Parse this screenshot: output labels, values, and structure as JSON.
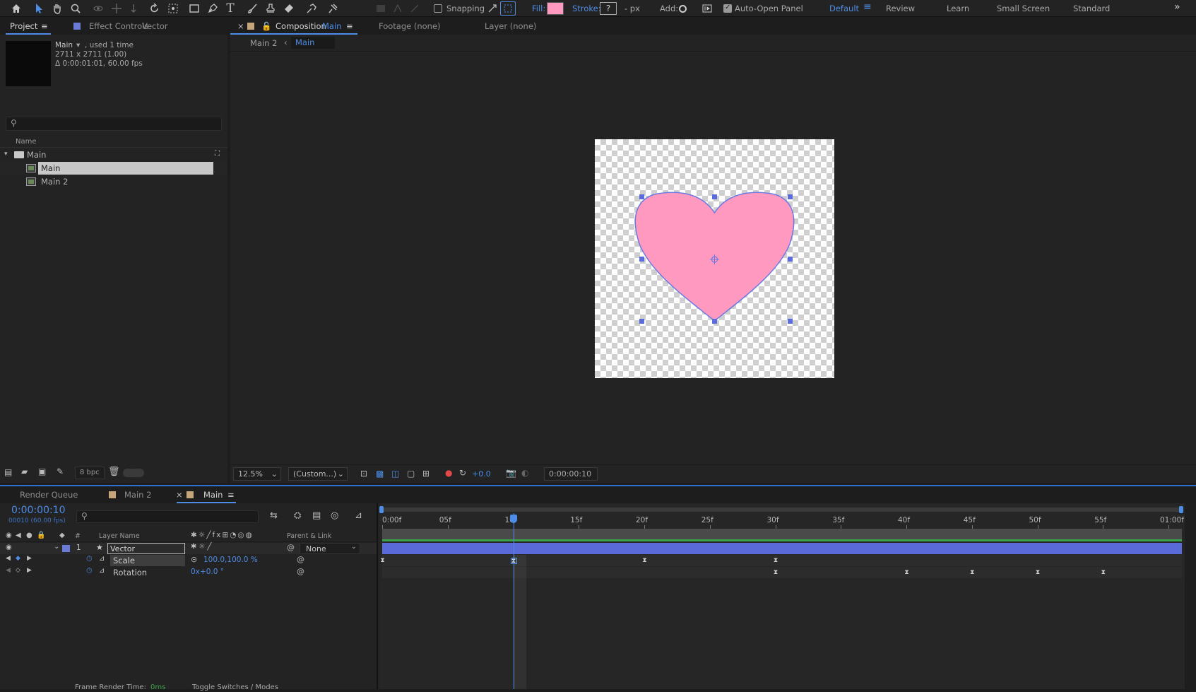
{
  "toolbar": {
    "snapping_label": "Snapping",
    "fill_label": "Fill:",
    "fill_color": "#ff99c0",
    "stroke_label": "Stroke:",
    "stroke_value": "?",
    "stroke_units": "- px",
    "add_label": "Add:",
    "auto_open_label": "Auto-Open Panel",
    "workspaces": [
      "Default",
      "Review",
      "Learn",
      "Small Screen",
      "Standard"
    ],
    "overflow": "»"
  },
  "project": {
    "tab_label": "Project",
    "effect_tab_label": "Effect Controls",
    "effect_tab_target": "Vector",
    "info_name": "Main",
    "info_used": ", used 1 time",
    "info_size": "2711 x 2711 (1.00)",
    "info_duration": "Δ 0:00:01:01, 60.00 fps",
    "column_name": "Name",
    "items": [
      "Main",
      "Main",
      "Main 2"
    ],
    "bpc": "8 bpc"
  },
  "viewer": {
    "tab_comp": "Composition",
    "tab_comp_name": "Main",
    "tab_footage": "Footage (none)",
    "tab_layer": "Layer (none)",
    "breadcrumb_prev": "Main 2",
    "breadcrumb_current": "Main",
    "zoom": "12.5%",
    "resolution": "(Custom...)",
    "exposure": "+0.0",
    "timecode": "0:00:00:10",
    "heart_color": "#ff99c0"
  },
  "timeline": {
    "tabs": [
      "Render Queue",
      "Main 2",
      "Main"
    ],
    "timecode": "0:00:00:10",
    "frame_info": "00010 (60.00 fps)",
    "col_layer_name": "Layer Name",
    "col_parent": "Parent & Link",
    "col_hash": "#",
    "layer_index": "1",
    "layer_name": "Vector",
    "parent_value": "None",
    "props": [
      {
        "name": "Scale",
        "value": "100.0,100.0 %"
      },
      {
        "name": "Rotation",
        "value": "0x+0.0 °"
      }
    ],
    "ruler": [
      "0:00f",
      "05f",
      "10f",
      "15f",
      "20f",
      "25f",
      "30f",
      "35f",
      "40f",
      "45f",
      "50f",
      "55f",
      "01:00f"
    ],
    "current_frame": 10,
    "scale_keyframes": [
      0,
      10,
      20,
      30
    ],
    "rotation_keyframes": [
      30,
      40,
      45,
      50,
      55
    ],
    "frame_render_label": "Frame Render Time:",
    "frame_render_value": "0ms",
    "toggle_label": "Toggle Switches / Modes"
  }
}
